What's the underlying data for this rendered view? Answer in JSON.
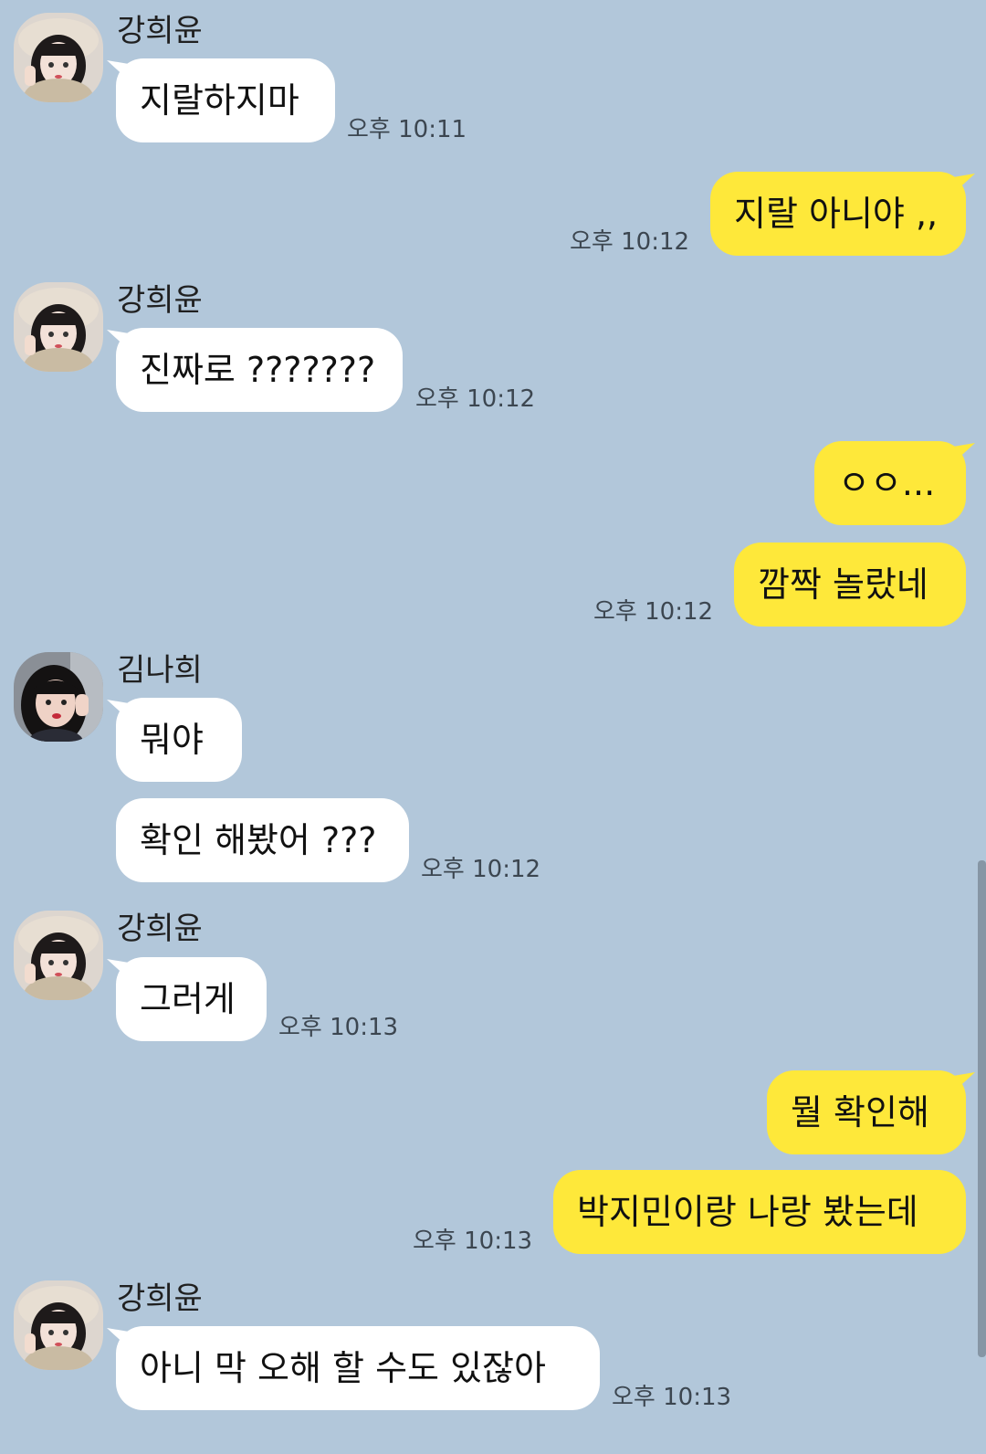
{
  "colors": {
    "background": "#b2c7da",
    "incoming_bubble": "#ffffff",
    "outgoing_bubble": "#fee83a"
  },
  "messages": [
    {
      "side": "in",
      "sender": "강희윤",
      "avatar": "avatar-beret",
      "text": "지랄하지마",
      "time": "오후 10:11"
    },
    {
      "side": "out",
      "text": "지랄 아니야 ,,",
      "time": "오후 10:12"
    },
    {
      "side": "in",
      "sender": "강희윤",
      "avatar": "avatar-beret",
      "text": "진짜로 ???????",
      "time": "오후 10:12"
    },
    {
      "side": "out",
      "text": "ㅇㅇ...",
      "time": ""
    },
    {
      "side": "out",
      "text": "깜짝 놀랐네",
      "time": "오후 10:12"
    },
    {
      "side": "in",
      "sender": "김나희",
      "avatar": "avatar-bob",
      "text": "뭐야",
      "time": ""
    },
    {
      "side": "in",
      "text": "확인 해봤어 ???",
      "time": "오후 10:12"
    },
    {
      "side": "in",
      "sender": "강희윤",
      "avatar": "avatar-beret",
      "text": "그러게",
      "time": "오후 10:13"
    },
    {
      "side": "out",
      "text": "뭘 확인해",
      "time": ""
    },
    {
      "side": "out",
      "text": "박지민이랑 나랑 봤는데",
      "time": "오후 10:13"
    },
    {
      "side": "in",
      "sender": "강희윤",
      "avatar": "avatar-beret",
      "text": "아니 막 오해 할 수도 있잖아",
      "time": "오후 10:13"
    }
  ]
}
